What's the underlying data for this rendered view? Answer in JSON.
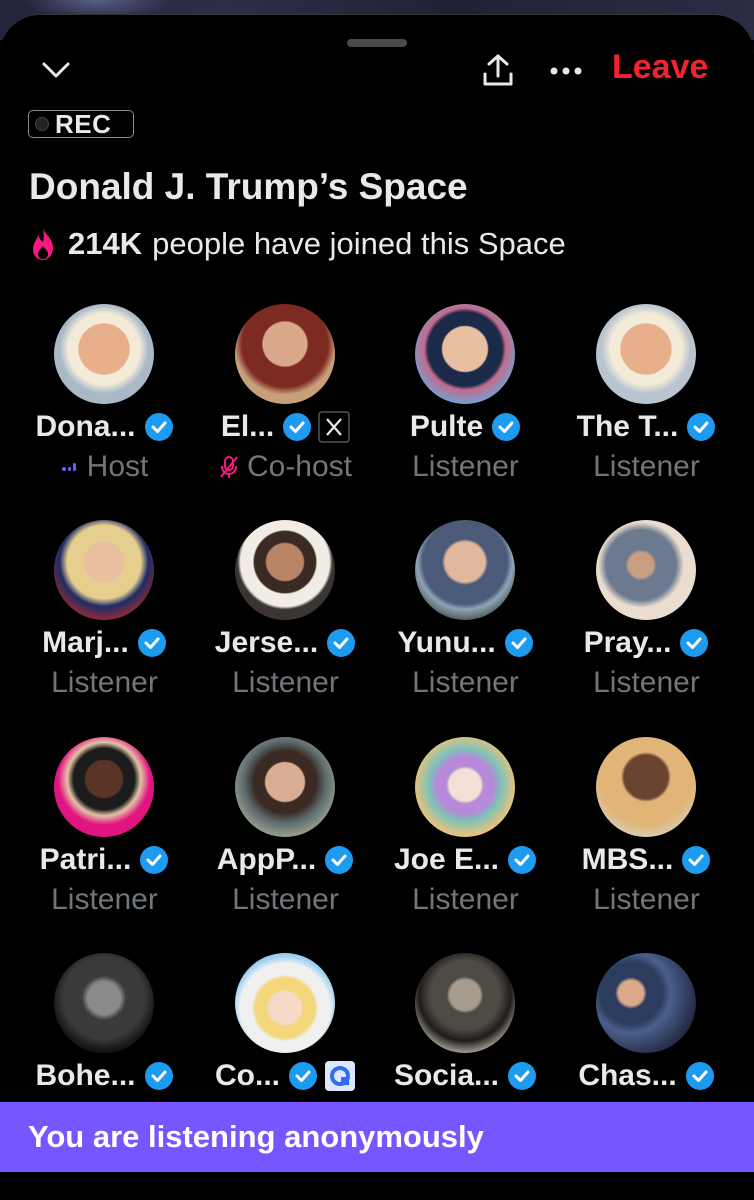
{
  "header": {
    "leave_label": "Leave",
    "rec_label": "REC",
    "title": "Donald J. Trump’s Space",
    "joined_count": "214K",
    "joined_text": "people have joined this Space",
    "icons": [
      "chevron-down-icon",
      "share-icon",
      "more-icon",
      "flame-icon"
    ]
  },
  "colors": {
    "leave": "#f4212e",
    "verified": "#1d9bf0",
    "banner": "#7856ff",
    "host_accent": "#7856ff",
    "cohost_accent": "#f91880",
    "muted": "#71767b"
  },
  "participants": [
    {
      "name": "Dona...",
      "role": "Host",
      "badge": ""
    },
    {
      "name": "El...",
      "role": "Co-host",
      "badge": "x-logo"
    },
    {
      "name": "Pulte",
      "role": "Listener",
      "badge": ""
    },
    {
      "name": "The T...",
      "role": "Listener",
      "badge": ""
    },
    {
      "name": "Marj...",
      "role": "Listener",
      "badge": ""
    },
    {
      "name": "Jerse...",
      "role": "Listener",
      "badge": ""
    },
    {
      "name": "Yunu...",
      "role": "Listener",
      "badge": ""
    },
    {
      "name": "Pray...",
      "role": "Listener",
      "badge": ""
    },
    {
      "name": "Patri...",
      "role": "Listener",
      "badge": ""
    },
    {
      "name": "AppP...",
      "role": "Listener",
      "badge": ""
    },
    {
      "name": "Joe E...",
      "role": "Listener",
      "badge": ""
    },
    {
      "name": "MBS...",
      "role": "Listener",
      "badge": ""
    },
    {
      "name": "Bohe...",
      "role": "",
      "badge": ""
    },
    {
      "name": "Co...",
      "role": "",
      "badge": "app-logo"
    },
    {
      "name": "Socia...",
      "role": "",
      "badge": ""
    },
    {
      "name": "Chas...",
      "role": "",
      "badge": ""
    }
  ],
  "banner": {
    "text": "You are listening anonymously"
  }
}
